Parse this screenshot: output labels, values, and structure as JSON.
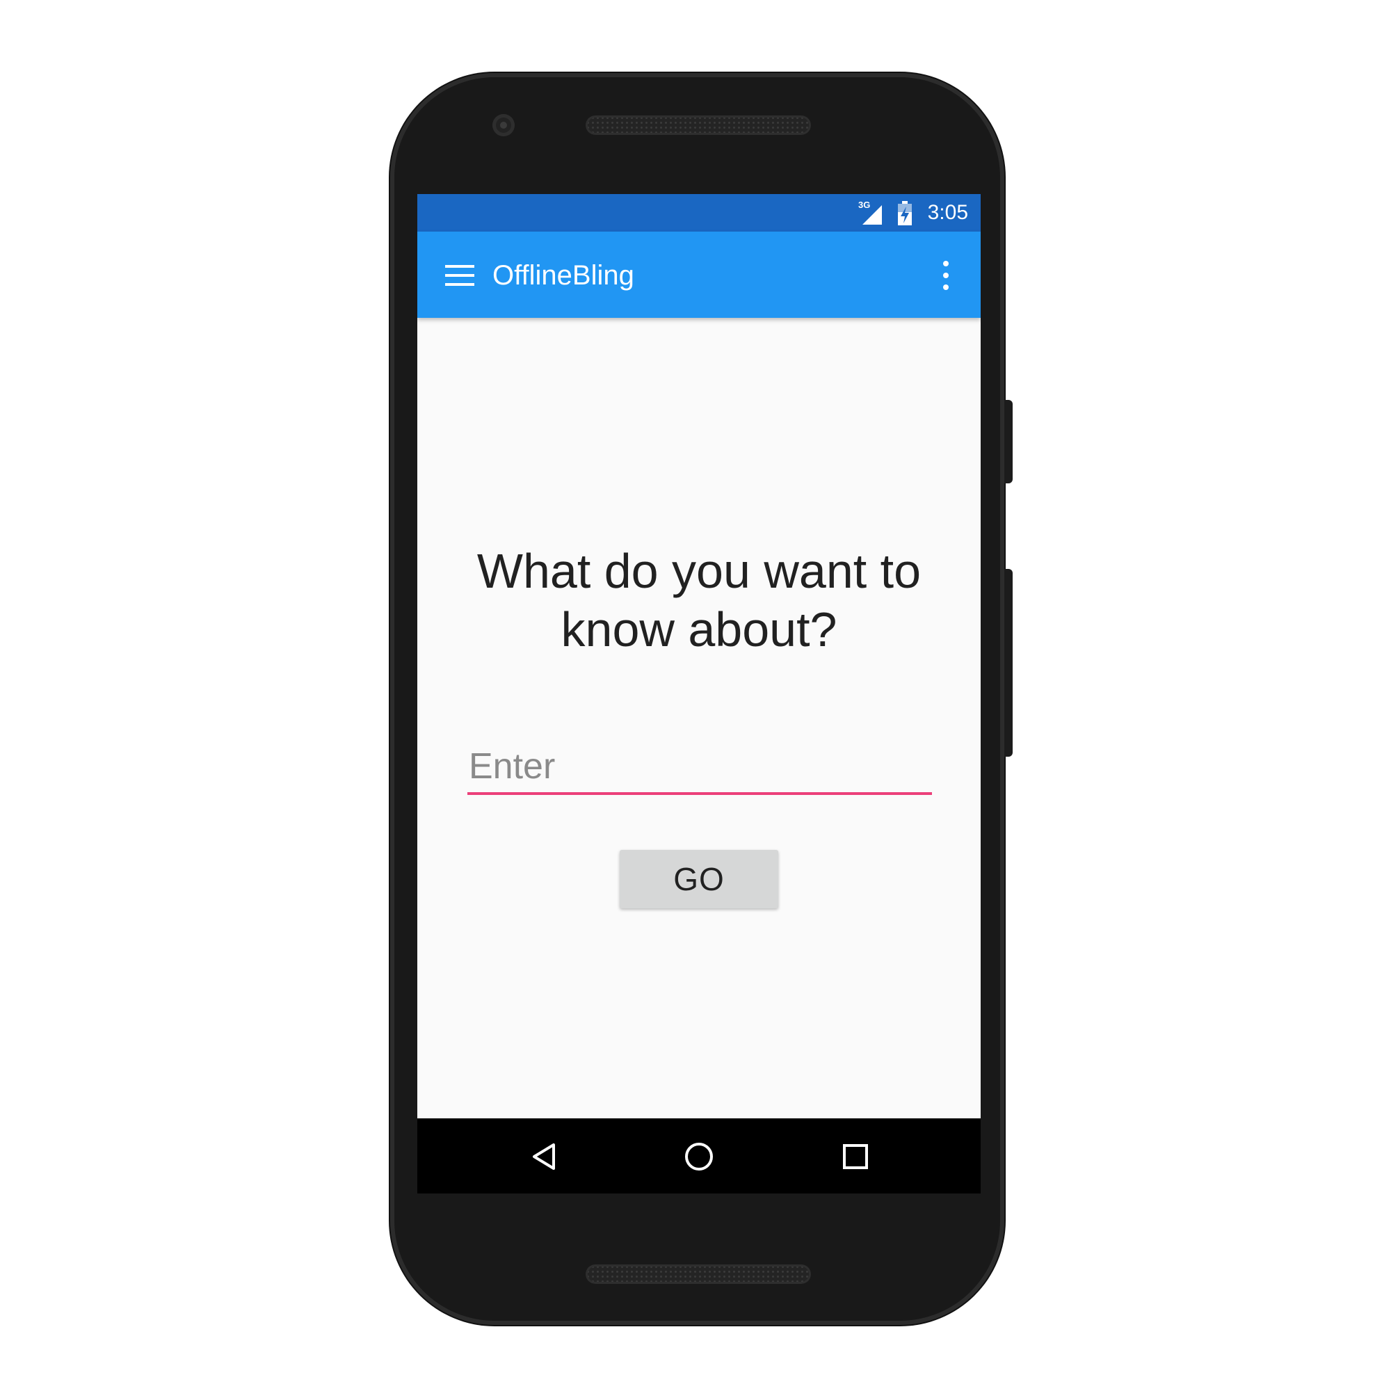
{
  "status_bar": {
    "network_type": "3G",
    "signal_icon": "cell-signal-icon",
    "battery_icon": "battery-charging-icon",
    "time": "3:05"
  },
  "app_bar": {
    "menu_icon": "hamburger-menu-icon",
    "title": "OfflineBling",
    "overflow_icon": "more-vert-icon"
  },
  "main": {
    "question": "What do you want to know about?",
    "input": {
      "placeholder": "Enter",
      "value": ""
    },
    "go_button_label": "GO"
  },
  "nav_bar": {
    "back_icon": "back-triangle-icon",
    "home_icon": "home-circle-icon",
    "recents_icon": "recents-square-icon"
  },
  "colors": {
    "status_bar": "#1a67c2",
    "app_bar": "#2196f3",
    "accent": "#ec407a",
    "screen_background": "#fafafa",
    "button_background": "#d6d7d7",
    "phone_body": "#191919"
  }
}
